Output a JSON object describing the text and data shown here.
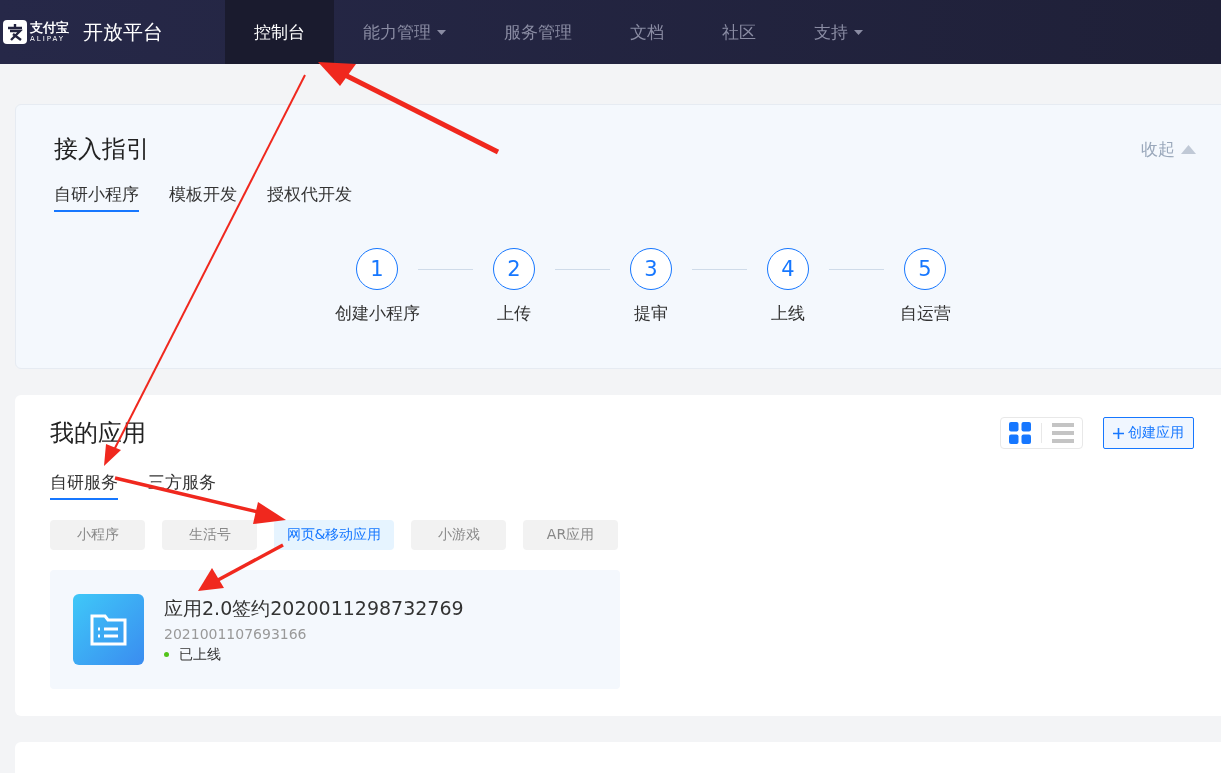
{
  "nav": {
    "logo_text": "支付宝",
    "logo_sub": "ALIPAY",
    "platform": "开放平台",
    "items": [
      {
        "label": "控制台",
        "selected": true,
        "dropdown": false
      },
      {
        "label": "能力管理",
        "selected": false,
        "dropdown": true
      },
      {
        "label": "服务管理",
        "selected": false,
        "dropdown": false
      },
      {
        "label": "文档",
        "selected": false,
        "dropdown": false
      },
      {
        "label": "社区",
        "selected": false,
        "dropdown": false
      },
      {
        "label": "支持",
        "selected": false,
        "dropdown": true
      }
    ]
  },
  "guide": {
    "title": "接入指引",
    "collapse": "收起",
    "tabs": [
      {
        "label": "自研小程序",
        "selected": true
      },
      {
        "label": "模板开发",
        "selected": false
      },
      {
        "label": "授权代开发",
        "selected": false
      }
    ],
    "steps": [
      {
        "number": "1",
        "label": "创建小程序"
      },
      {
        "number": "2",
        "label": "上传"
      },
      {
        "number": "3",
        "label": "提审"
      },
      {
        "number": "4",
        "label": "上线"
      },
      {
        "number": "5",
        "label": "自运营"
      }
    ]
  },
  "apps": {
    "title": "我的应用",
    "views": [
      {
        "kind": "grid",
        "selected": true
      },
      {
        "kind": "list",
        "selected": false
      }
    ],
    "create_button": "创建应用",
    "tabs": [
      {
        "label": "自研服务",
        "selected": true
      },
      {
        "label": "三方服务",
        "selected": false
      }
    ],
    "categories": [
      {
        "label": "小程序",
        "selected": false
      },
      {
        "label": "生活号",
        "selected": false
      },
      {
        "label": "网页&移动应用",
        "selected": true
      },
      {
        "label": "小游戏",
        "selected": false
      },
      {
        "label": "AR应用",
        "selected": false
      }
    ],
    "items": [
      {
        "name": "应用2.0签约2020011298732769",
        "id": "2021001107693166",
        "status": "已上线",
        "color": "#52c41a"
      }
    ]
  }
}
